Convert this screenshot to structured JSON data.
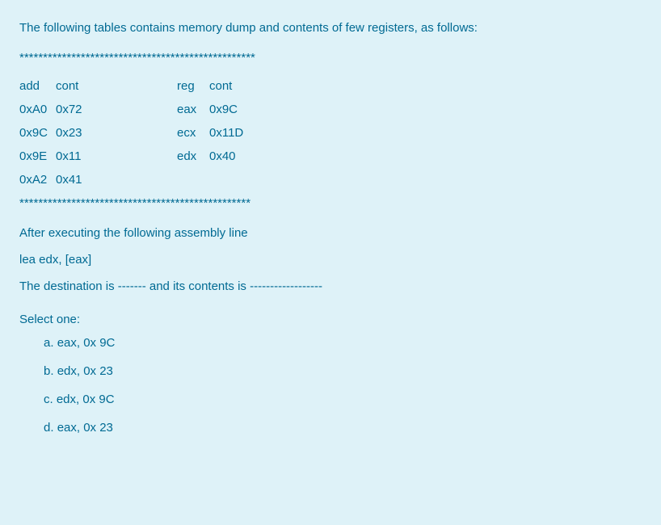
{
  "intro": "The following tables contains memory dump and contents of few registers, as follows:",
  "stars1": "**************************************************",
  "header": {
    "c1": "add",
    "c2": "cont",
    "c3": "reg",
    "c4": "cont"
  },
  "rows": [
    {
      "c1": "0xA0",
      "c2": "0x72",
      "c3": "eax",
      "c4": "0x9C"
    },
    {
      "c1": "0x9C",
      "c2": "0x23",
      "c3": " ecx",
      "c4": "0x11D"
    },
    {
      "c1": "0x9E",
      "c2": "0x11",
      "c3": "edx",
      "c4": "0x40"
    },
    {
      "c1": "0xA2",
      "c2": "0x41",
      "c3": "",
      "c4": ""
    }
  ],
  "stars2": "*************************************************",
  "after1": "After executing the following assembly line",
  "after2": "lea edx, [eax]",
  "after3": "The destination is ------- and its contents is ------------------",
  "select_label": "Select one:",
  "options": [
    {
      "letter": "a.",
      "text": "eax, 0x 9C"
    },
    {
      "letter": "b.",
      "text": "edx, 0x 23"
    },
    {
      "letter": "c.",
      "text": "edx, 0x 9C"
    },
    {
      "letter": "d.",
      "text": "eax, 0x 23"
    }
  ]
}
